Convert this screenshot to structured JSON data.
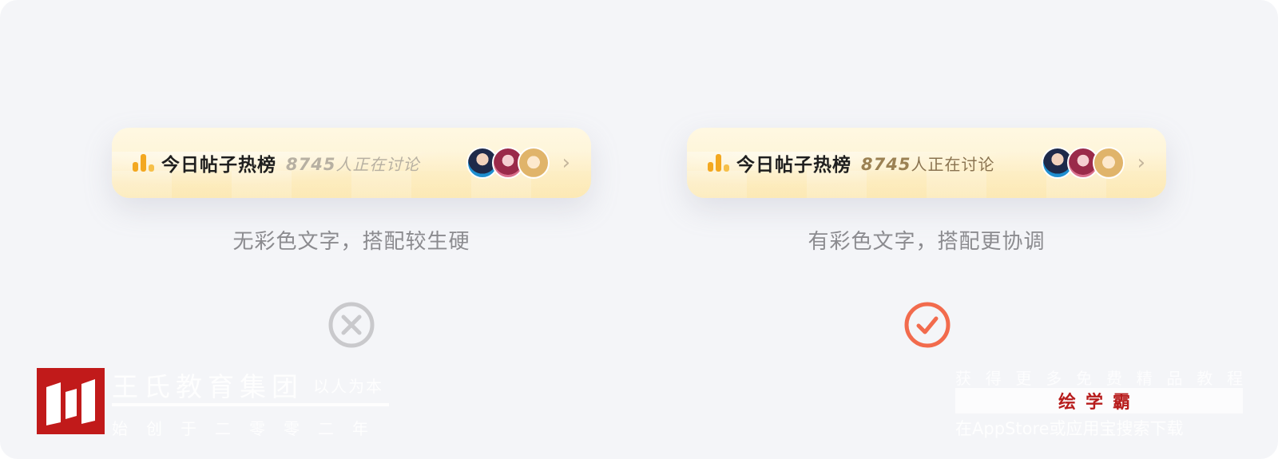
{
  "colors": {
    "background": "#f4f5f8",
    "panel_bg": "#fdf0cc",
    "bar_icon": "#f3a820",
    "caption": "#8b8b8f",
    "wrong_icon": "#c9c9cc",
    "correct_icon": "#f26b4d",
    "watermark_red": "#c11a1a"
  },
  "left_panel": {
    "icon": "bar-chart-icon",
    "title": "今日帖子热榜",
    "count": "8745",
    "count_suffix": "人正在讨论",
    "avatars": [
      "avatar-1",
      "avatar-2",
      "avatar-3"
    ],
    "chevron": "›",
    "caption": "无彩色文字，搭配较生硬",
    "verdict_icon": "cross-circle-icon"
  },
  "right_panel": {
    "icon": "bar-chart-icon",
    "title": "今日帖子热榜",
    "count": "8745",
    "count_suffix": "人正在讨论",
    "avatars": [
      "avatar-1",
      "avatar-2",
      "avatar-3"
    ],
    "chevron": "›",
    "caption": "有彩色文字，搭配更协调",
    "verdict_icon": "check-circle-icon"
  },
  "watermark_left": {
    "logo": "wang-logo",
    "title": "王氏教育集团",
    "tagline": "以人为本",
    "subtitle": "始创于二零零二年"
  },
  "watermark_right": {
    "line1": "获得更多免费精品教程",
    "line2": "绘学霸",
    "line3": "在AppStore或应用宝搜索下载"
  }
}
